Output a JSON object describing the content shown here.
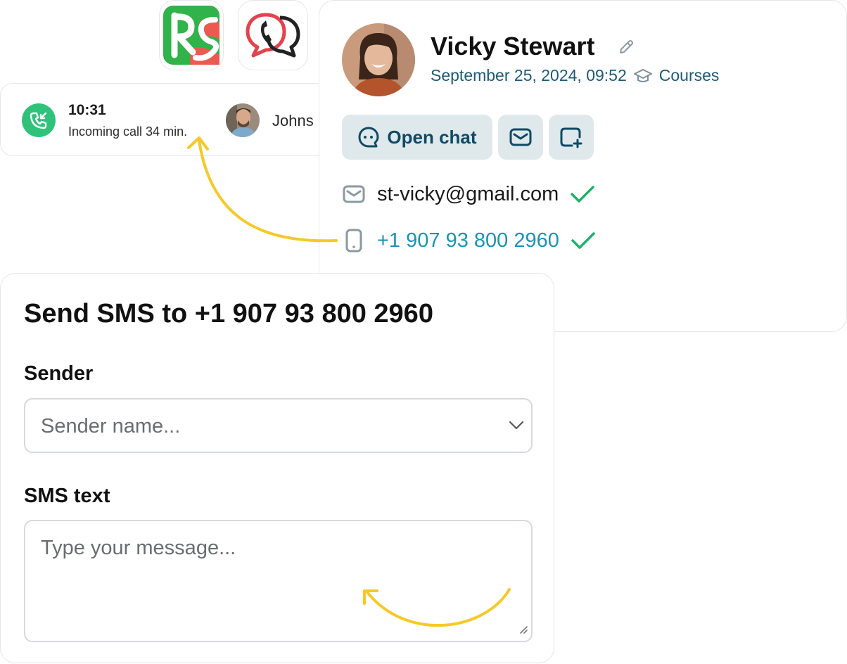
{
  "apps": [
    {
      "name": "RS app",
      "icon": "rs-logo-icon"
    },
    {
      "name": "Call chat app",
      "icon": "phone-chat-icon"
    }
  ],
  "call": {
    "time": "10:31",
    "description": "Incoming call 34 min.",
    "caller_name": "Johns",
    "status_color": "#2fc27b"
  },
  "contact": {
    "name": "Vicky Stewart",
    "datetime": "September 25, 2024, 09:52",
    "course_label": "Courses",
    "open_chat_label": "Open chat",
    "email": "st-vicky@gmail.com",
    "phone": "+1 907 93 800 2960",
    "verified_color": "#1bb36a"
  },
  "sms": {
    "title": "Send SMS to +1 907 93 800 2960",
    "sender_label": "Sender",
    "sender_placeholder": "Sender name...",
    "text_label": "SMS text",
    "text_placeholder": "Type your message..."
  },
  "colors": {
    "accent_arrow": "#f6c928",
    "button_bg": "#dfe8eb",
    "button_text": "#0f4a66",
    "phone_link": "#1a93b5"
  }
}
